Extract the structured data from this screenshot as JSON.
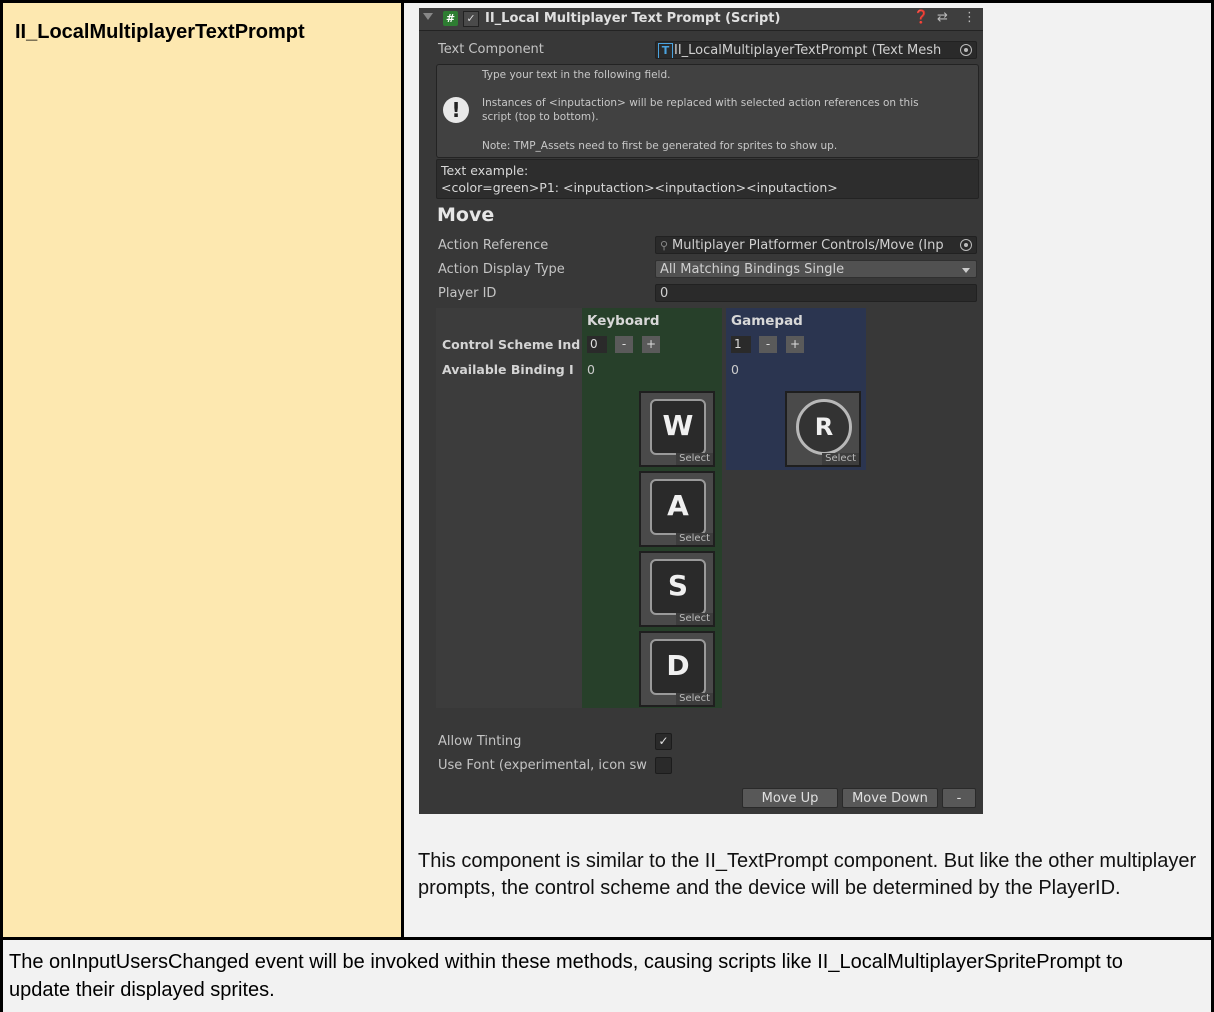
{
  "component_name": "II_LocalMultiplayerTextPrompt",
  "inspector": {
    "header": {
      "title": "II_Local Multiplayer Text Prompt (Script)",
      "enabled": true,
      "hash_glyph": "#",
      "check_glyph": "✓",
      "help_glyph": "❓",
      "preset_glyph": "⇄",
      "menu_glyph": "⋮"
    },
    "text_component": {
      "label": "Text Component",
      "value": "II_LocalMultiplayerTextPrompt (Text Mesh",
      "icon_letter": "T"
    },
    "help_box": {
      "warn_glyph": "!",
      "line1": "Type your text in the following field.",
      "line2": "Instances of <inputaction> will be replaced with selected action references on this",
      "line3": "script (top to bottom).",
      "line4": "Note: TMP_Assets need to first be generated for sprites to show up."
    },
    "text_example": {
      "line1": "Text example:",
      "line2": "<color=green>P1: <inputaction><inputaction><inputaction>"
    },
    "section_title": "Move",
    "action_reference": {
      "label": "Action Reference",
      "value": "Multiplayer Platformer Controls/Move (Inp"
    },
    "action_display_type": {
      "label": "Action Display Type",
      "value": "All Matching Bindings Single"
    },
    "player_id": {
      "label": "Player ID",
      "value": "0"
    },
    "binding_table": {
      "row_control_scheme": "Control Scheme Ind",
      "row_available_binding": "Available Binding I",
      "minus_label": "-",
      "plus_label": "+",
      "columns": [
        {
          "name": "Keyboard",
          "scheme_index": "0",
          "available_binding": "0",
          "keys": [
            {
              "glyph": "W",
              "select_label": "Select"
            },
            {
              "glyph": "A",
              "select_label": "Select"
            },
            {
              "glyph": "S",
              "select_label": "Select"
            },
            {
              "glyph": "D",
              "select_label": "Select"
            }
          ]
        },
        {
          "name": "Gamepad",
          "scheme_index": "1",
          "available_binding": "0",
          "keys": [
            {
              "glyph": "R",
              "select_label": "Select"
            }
          ]
        }
      ]
    },
    "allow_tinting": {
      "label": "Allow Tinting",
      "checked": true,
      "check_glyph": "✓"
    },
    "use_font": {
      "label": "Use Font (experimental, icon sw",
      "checked": false
    },
    "buttons": {
      "move_up": "Move Up",
      "move_down": "Move Down",
      "remove": "-"
    }
  },
  "description": "This component is similar to the II_TextPrompt component. But like the other multiplayer prompts, the control scheme and the device will be determined by the PlayerID.",
  "footer_text": "The onInputUsersChanged event will be invoked within these methods, causing scripts like II_LocalMultiplayerSpritePrompt to update their displayed sprites.",
  "colors": {
    "left_cell": "#fde8b0",
    "right_cell": "#f2f2f2",
    "inspector_bg": "#383838",
    "keyboard_column": "#27402a",
    "gamepad_column": "#2b3550"
  }
}
